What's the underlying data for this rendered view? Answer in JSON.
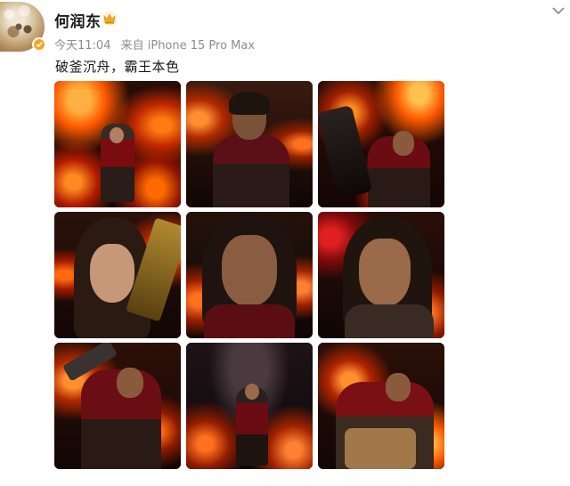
{
  "user": {
    "name": "何润东",
    "time": "今天11:04",
    "source": "来自 iPhone 15 Pro Max"
  },
  "post": {
    "text": "破釜沉舟，霸王本色",
    "images": [
      {
        "label": "image-1"
      },
      {
        "label": "image-2"
      },
      {
        "label": "image-3"
      },
      {
        "label": "image-4"
      },
      {
        "label": "image-5"
      },
      {
        "label": "image-6"
      },
      {
        "label": "image-7"
      },
      {
        "label": "image-8"
      },
      {
        "label": "image-9"
      }
    ]
  },
  "icons": {
    "crown": "crown-icon",
    "verified": "verified-badge-icon",
    "more": "chevron-down-icon"
  },
  "colors": {
    "verified": "#f5a623",
    "crown": "#f5a623",
    "meta_text": "#8c8c8c",
    "fire": "#ff6a00"
  }
}
